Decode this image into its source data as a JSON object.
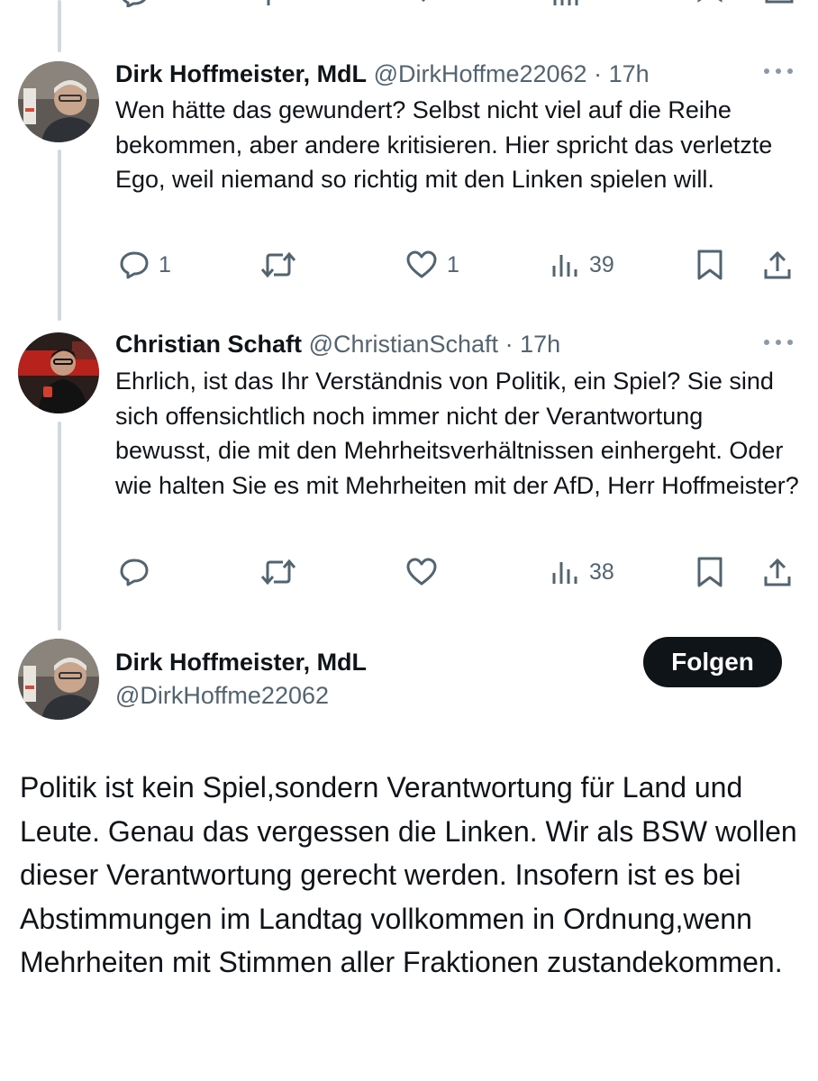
{
  "reply1": {
    "author_name": "Dirk Hoffmeister, MdL",
    "handle": "@DirkHoffme22062",
    "time": "· 17h",
    "text": "Wen hätte das gewundert? Selbst nicht viel auf die Reihe bekommen, aber andere kritisieren. Hier spricht das verletzte Ego, weil niemand so richtig mit den Linken spielen will.",
    "reply_count": "1",
    "like_count": "1",
    "view_count": "39"
  },
  "reply2": {
    "author_name": "Christian Schaft",
    "handle": "@ChristianSchaft",
    "time": "· 17h",
    "text": "Ehrlich, ist das Ihr Verständnis von Politik, ein Spiel? Sie sind sich offensichtlich noch immer nicht der Verantwortung bewusst, die mit den Mehrheitsverhältnissen einhergeht. Oder wie halten Sie es mit Mehrheiten mit der AfD, Herr Hoffmeister?",
    "view_count": "38"
  },
  "main_tweet": {
    "author_name": "Dirk Hoffmeister, MdL",
    "handle": "@DirkHoffme22062",
    "follow_label": "Folgen",
    "text": "Politik ist kein Spiel,sondern Verantwortung für Land und Leute. Genau das vergessen die Linken. Wir als BSW wollen dieser Verantwortung gerecht werden. Insofern ist es bei Abstimmungen im Landtag vollkommen in Ordnung,wenn Mehrheiten mit Stimmen aller Fraktionen zustandekommen."
  },
  "colors": {
    "text": "#0f1419",
    "secondary": "#536471",
    "thread_line": "#cfd9de",
    "follow_bg": "#0f1419"
  },
  "icons": [
    "reply-icon",
    "retweet-icon",
    "like-icon",
    "views-icon",
    "bookmark-icon",
    "share-icon",
    "more-icon"
  ]
}
